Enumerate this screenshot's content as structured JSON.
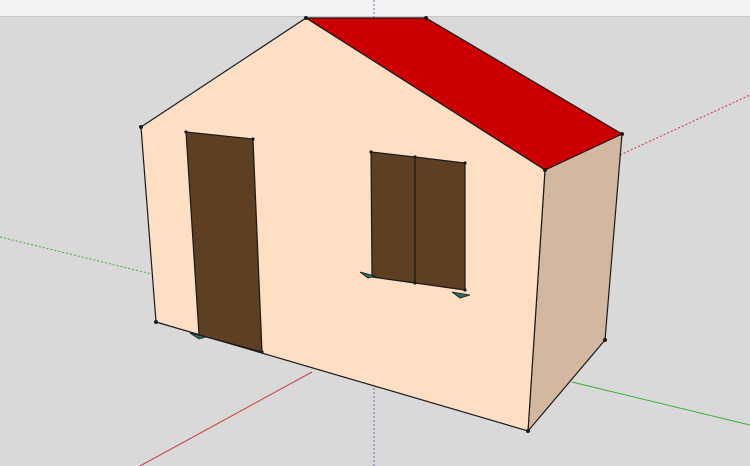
{
  "app": {
    "view": "sketchup-3d-viewport"
  },
  "colors": {
    "background": "#d9d9d9",
    "toolbar": "#f2f2f2",
    "wall_front": "#ffdfc4",
    "wall_side": "#d2b8a0",
    "roof": "#cc0000",
    "door": "#5e3f22",
    "window": "#5e3f22",
    "edge": "#1a1a1a",
    "axis_red": "#c83c3c",
    "axis_green": "#3cae3c",
    "axis_blue": "#6a6ad0",
    "hinge": "#2d6e66"
  },
  "icons": {
    "origin": "axis-origin-icon"
  }
}
